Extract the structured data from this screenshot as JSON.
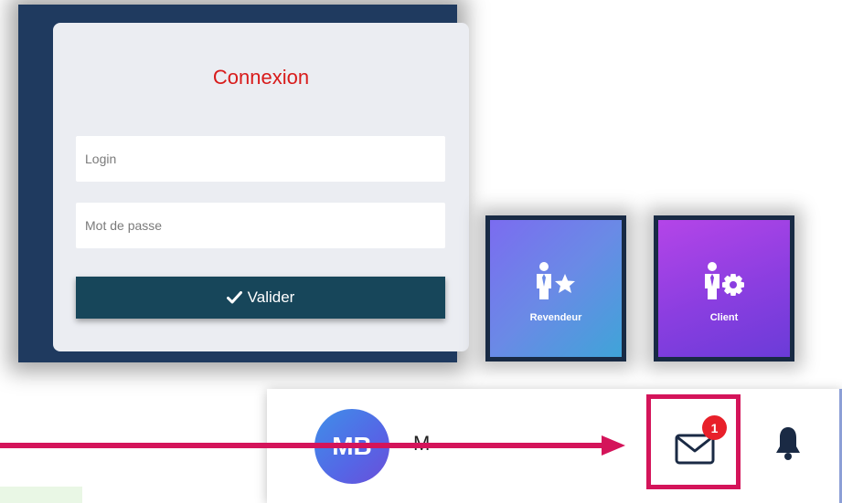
{
  "login": {
    "title": "Connexion",
    "login_placeholder": "Login",
    "password_placeholder": "Mot de passe",
    "submit_label": "Valider"
  },
  "roles": [
    {
      "label": "Revendeur",
      "icon": "user-star-icon"
    },
    {
      "label": "Client",
      "icon": "user-gear-icon"
    }
  ],
  "header": {
    "avatar_initials": "MB",
    "user_name": "M",
    "notification_count": "1",
    "highlight_color": "#d4145a"
  },
  "colors": {
    "title_red": "#d81b1b",
    "button_bg": "#17465a",
    "arrow": "#d4145a"
  }
}
